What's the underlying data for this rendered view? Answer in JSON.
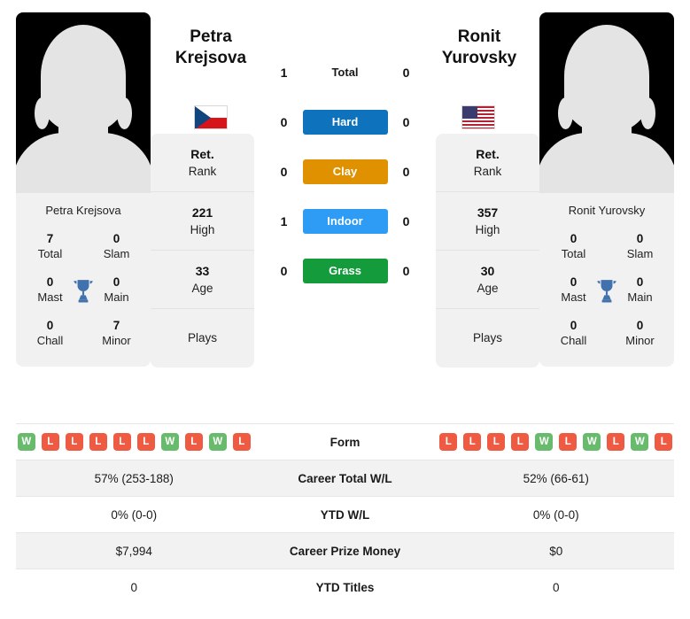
{
  "players": {
    "left": {
      "name": "Petra Krejsova",
      "name_line1": "Petra",
      "name_line2": "Krejsova",
      "flag": "cz-flag-icon",
      "avatar": "player-avatar-placeholder",
      "titles": {
        "total": "7",
        "total_label": "Total",
        "slam": "0",
        "slam_label": "Slam",
        "mast": "0",
        "mast_label": "Mast",
        "main": "0",
        "main_label": "Main",
        "chall": "0",
        "chall_label": "Chall",
        "minor": "7",
        "minor_label": "Minor"
      },
      "rank": {
        "rank_value": "Ret.",
        "rank_label": "Rank",
        "high_value": "221",
        "high_label": "High",
        "age_value": "33",
        "age_label": "Age",
        "plays_label": "Plays"
      },
      "form": [
        "W",
        "L",
        "L",
        "L",
        "L",
        "L",
        "W",
        "L",
        "W",
        "L"
      ],
      "career_total_wl": "57% (253-188)",
      "ytd_wl": "0% (0-0)",
      "career_prize_money": "$7,994",
      "ytd_titles": "0"
    },
    "right": {
      "name": "Ronit Yurovsky",
      "name_line1": "Ronit",
      "name_line2": "Yurovsky",
      "flag": "us-flag-icon",
      "avatar": "player-avatar-placeholder",
      "titles": {
        "total": "0",
        "total_label": "Total",
        "slam": "0",
        "slam_label": "Slam",
        "mast": "0",
        "mast_label": "Mast",
        "main": "0",
        "main_label": "Main",
        "chall": "0",
        "chall_label": "Chall",
        "minor": "0",
        "minor_label": "Minor"
      },
      "rank": {
        "rank_value": "Ret.",
        "rank_label": "Rank",
        "high_value": "357",
        "high_label": "High",
        "age_value": "30",
        "age_label": "Age",
        "plays_label": "Plays"
      },
      "form": [
        "L",
        "L",
        "L",
        "L",
        "W",
        "L",
        "W",
        "L",
        "W",
        "L"
      ],
      "career_total_wl": "52% (66-61)",
      "ytd_wl": "0% (0-0)",
      "career_prize_money": "$0",
      "ytd_titles": "0"
    }
  },
  "h2h": [
    {
      "label": "Total",
      "left": "1",
      "right": "0",
      "badge": false,
      "color": ""
    },
    {
      "label": "Hard",
      "left": "0",
      "right": "0",
      "badge": true,
      "color": "#0e72bd"
    },
    {
      "label": "Clay",
      "left": "0",
      "right": "0",
      "badge": true,
      "color": "#e09100"
    },
    {
      "label": "Indoor",
      "left": "1",
      "right": "0",
      "badge": true,
      "color": "#2e9bf5"
    },
    {
      "label": "Grass",
      "left": "0",
      "right": "0",
      "badge": true,
      "color": "#139b3c"
    }
  ],
  "stats_rows": [
    {
      "label": "Form",
      "key": "form",
      "type": "form"
    },
    {
      "label": "Career Total W/L",
      "key": "career_total_wl",
      "type": "text"
    },
    {
      "label": "YTD W/L",
      "key": "ytd_wl",
      "type": "text"
    },
    {
      "label": "Career Prize Money",
      "key": "career_prize_money",
      "type": "text"
    },
    {
      "label": "YTD Titles",
      "key": "ytd_titles",
      "type": "text"
    }
  ],
  "colors": {
    "win": "#68bb6c",
    "loss": "#ef5a43",
    "trophy": "#4272ad",
    "card_bg": "#f1f1f1",
    "row_shade": "#f2f2f2"
  }
}
